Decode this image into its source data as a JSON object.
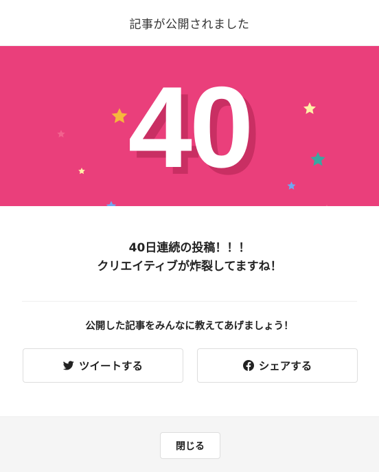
{
  "header": {
    "title": "記事が公開されました"
  },
  "banner": {
    "background": "#ea3f7b",
    "number": "40",
    "stars": [
      {
        "color": "#f6b73c"
      },
      {
        "color": "#f2628e"
      },
      {
        "color": "#fff1a8"
      },
      {
        "color": "#7b68d9"
      },
      {
        "color": "#fff1a8"
      },
      {
        "color": "#3aa7a1"
      },
      {
        "color": "#6fa8f0"
      },
      {
        "color": "#6fa8f0"
      },
      {
        "color": "#f2628e"
      },
      {
        "color": "#7b68d9"
      },
      {
        "color": "#3aa7a1"
      },
      {
        "color": "#f6b73c"
      }
    ]
  },
  "message": {
    "line1": "40日連続の投稿！！！",
    "line2": "クリエイティブが炸裂してますね！"
  },
  "share": {
    "prompt": "公開した記事をみんなに教えてあげましょう！",
    "twitter_label": "ツイートする",
    "facebook_label": "シェアする",
    "twitter_icon": "twitter-bird-icon",
    "facebook_icon": "facebook-icon"
  },
  "footer": {
    "close_label": "閉じる"
  }
}
